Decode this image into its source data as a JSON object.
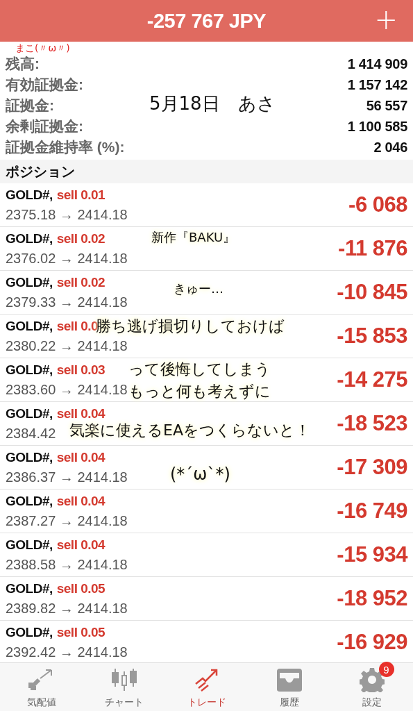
{
  "header": {
    "title": "-257 767 JPY",
    "add_button": "+"
  },
  "account": [
    {
      "label": "残高:",
      "value": "1 414 909"
    },
    {
      "label": "有効証拠金:",
      "value": "1 157 142"
    },
    {
      "label": "証拠金:",
      "value": "56 557"
    },
    {
      "label": "余剰証拠金:",
      "value": "1 100 585"
    },
    {
      "label": "証拠金維持率 (%):",
      "value": "2 046"
    }
  ],
  "positions_heading": "ポジション",
  "positions": [
    {
      "symbol": "GOLD#,",
      "order": "sell 0.01",
      "prices": "2375.18 → 2414.18",
      "profit": "-6 068"
    },
    {
      "symbol": "GOLD#,",
      "order": "sell 0.02",
      "prices": "2376.02 → 2414.18",
      "profit": "-11 876"
    },
    {
      "symbol": "GOLD#,",
      "order": "sell 0.02",
      "prices": "2379.33 → 2414.18",
      "profit": "-10 845"
    },
    {
      "symbol": "GOLD#,",
      "order": "sell 0.0",
      "prices": "2380.22 → 2414.18",
      "profit": "-15 853"
    },
    {
      "symbol": "GOLD#,",
      "order": "sell 0.03",
      "prices": "2383.60 → 2414.18",
      "profit": "-14 275"
    },
    {
      "symbol": "GOLD#,",
      "order": "sell 0.04",
      "prices": "2384.42",
      "profit": "-18 523"
    },
    {
      "symbol": "GOLD#,",
      "order": "sell 0.04",
      "prices": "2386.37 → 2414.18",
      "profit": "-17 309"
    },
    {
      "symbol": "GOLD#,",
      "order": "sell 0.04",
      "prices": "2387.27 → 2414.18",
      "profit": "-16 749"
    },
    {
      "symbol": "GOLD#,",
      "order": "sell 0.04",
      "prices": "2388.58 → 2414.18",
      "profit": "-15 934"
    },
    {
      "symbol": "GOLD#,",
      "order": "sell 0.05",
      "prices": "2389.82 → 2414.18",
      "profit": "-18 952"
    },
    {
      "symbol": "GOLD#,",
      "order": "sell 0.05",
      "prices": "2392.42 → 2414.18",
      "profit": "-16 929"
    }
  ],
  "tabs": [
    {
      "kind": "quotes",
      "label": "気配値",
      "selected": false
    },
    {
      "kind": "chart",
      "label": "チャート",
      "selected": false
    },
    {
      "kind": "trade",
      "label": "トレード",
      "selected": true
    },
    {
      "kind": "history",
      "label": "履歴",
      "selected": false
    },
    {
      "kind": "settings",
      "label": "設定",
      "selected": false,
      "badge": "9"
    }
  ],
  "annotations": [
    {
      "kind": "pen",
      "text": "まこ(〃ω〃)",
      "color": "#e02020"
    },
    {
      "kind": "plain",
      "text": "5月18日　あさ",
      "color": "#111111"
    },
    {
      "kind": "glow",
      "text": "新作『BAKU』",
      "color": "#111111"
    },
    {
      "kind": "glow",
      "text": "きゅー…",
      "color": "#111111"
    },
    {
      "kind": "glow",
      "text": "勝ち逃げ損切りしておけば",
      "color": "#111111"
    },
    {
      "kind": "glow",
      "text": "って後悔してしまう",
      "color": "#111111"
    },
    {
      "kind": "glow",
      "text": "もっと何も考えずに",
      "color": "#111111"
    },
    {
      "kind": "glow",
      "text": "気楽に使えるEAをつくらないと！",
      "color": "#111111"
    },
    {
      "kind": "glow",
      "text": "(*´ω`*)",
      "color": "#111111"
    }
  ]
}
